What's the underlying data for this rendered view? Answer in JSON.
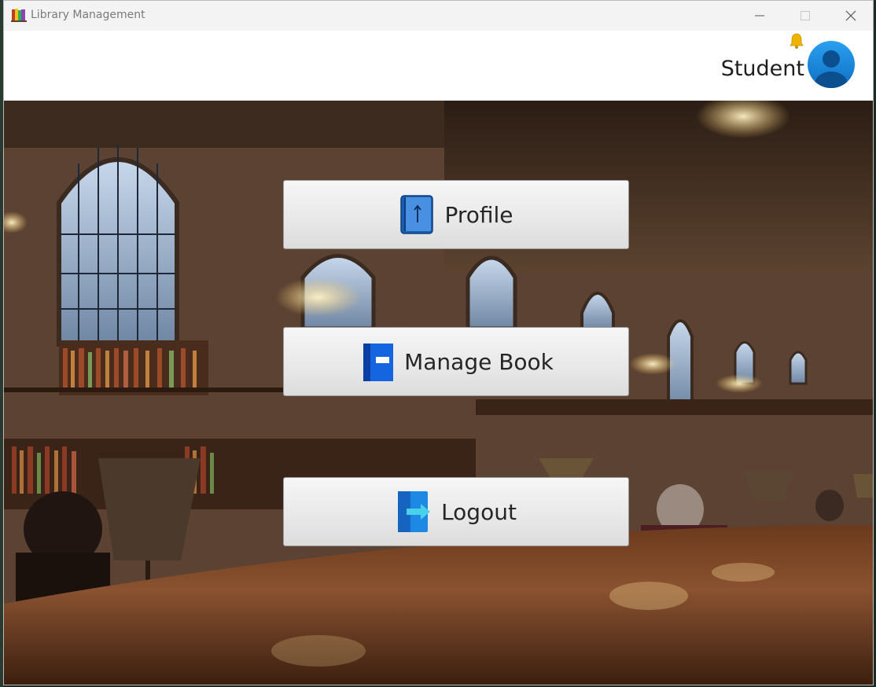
{
  "window": {
    "title": "Library Management"
  },
  "header": {
    "user_role": "Student",
    "notification_icon": "bell-icon",
    "avatar_icon": "user-avatar-icon"
  },
  "menu": {
    "profile": {
      "label": "Profile",
      "icon": "profile-book-icon"
    },
    "manage_book": {
      "label": "Manage Book",
      "icon": "book-icon"
    },
    "logout": {
      "label": "Logout",
      "icon": "logout-icon"
    }
  },
  "colors": {
    "accent_blue": "#1e88e5",
    "bell_gold": "#f0b400",
    "button_face": "#e9e9e9"
  }
}
